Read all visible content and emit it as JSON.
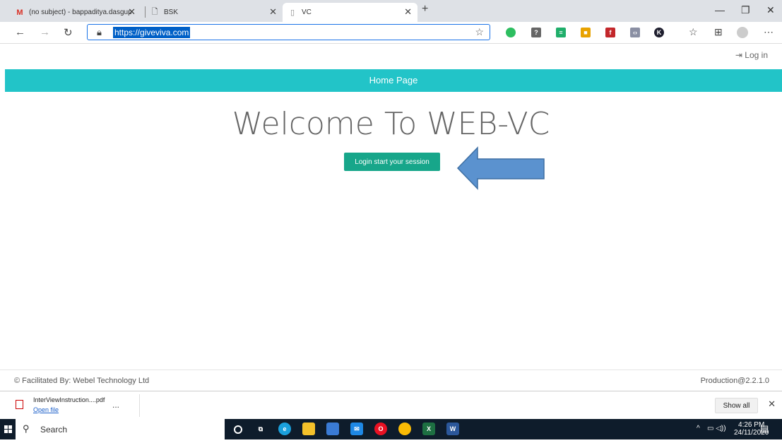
{
  "browser": {
    "tabs": [
      {
        "title": "(no subject) - bappaditya.dasgup",
        "icon": "gmail-icon",
        "active": false
      },
      {
        "title": "BSK",
        "icon": "page-icon",
        "active": false
      },
      {
        "title": "VC",
        "icon": "page-icon",
        "active": true
      }
    ],
    "new_tab": "+",
    "url": "https://giveviva.com",
    "window_controls": {
      "minimize": "—",
      "restore": "❐",
      "close": "✕"
    }
  },
  "page": {
    "login_link": "Log in",
    "nav_title": "Home Page",
    "heading": "Welcome To WEB-VC",
    "start_button": "Login start your session",
    "arrow_color": "#5b92cf",
    "footer_left": "© Facilitated By: Webel Technology Ltd",
    "footer_right": "Production@2.2.1.0",
    "accent_color": "#22c4c8",
    "button_color": "#17a68a"
  },
  "downloads": {
    "file_name": "InterViewInstruction....pdf",
    "open_label": "Open file",
    "more": "...",
    "show_all": "Show all"
  },
  "taskbar": {
    "search_placeholder": "Search",
    "time": "4:26 PM",
    "date": "24/11/2020"
  }
}
